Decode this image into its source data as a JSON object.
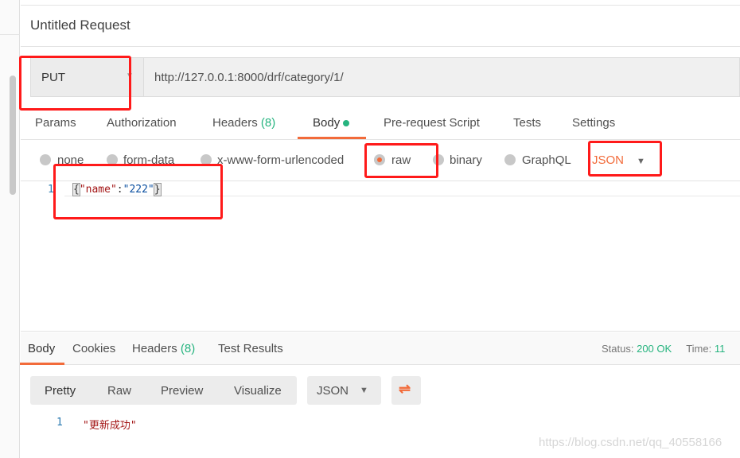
{
  "request": {
    "title": "Untitled Request",
    "method": "PUT",
    "url": "http://127.0.0.1:8000/drf/category/1/"
  },
  "tabs": [
    {
      "label": "Params"
    },
    {
      "label": "Authorization"
    },
    {
      "label": "Headers",
      "count": "(8)"
    },
    {
      "label": "Body"
    },
    {
      "label": "Pre-request Script"
    },
    {
      "label": "Tests"
    },
    {
      "label": "Settings"
    }
  ],
  "body_types": [
    "none",
    "form-data",
    "x-www-form-urlencoded",
    "raw",
    "binary",
    "GraphQL"
  ],
  "body_type_selected": "raw",
  "body_format": "JSON",
  "editor": {
    "line": "1",
    "brace_open": "{",
    "key": "\"name\"",
    "colon": ":",
    "value": "\"222\"",
    "brace_close": "}"
  },
  "response": {
    "tabs": [
      {
        "label": "Body"
      },
      {
        "label": "Cookies"
      },
      {
        "label": "Headers",
        "count": "(8)"
      },
      {
        "label": "Test Results"
      }
    ],
    "status_label": "Status:",
    "status_value": "200 OK",
    "time_label": "Time:",
    "time_value": "11",
    "view_modes": [
      "Pretty",
      "Raw",
      "Preview",
      "Visualize"
    ],
    "format": "JSON",
    "line": "1",
    "content": "\"更新成功\""
  },
  "watermark": "https://blog.csdn.net/qq_40558166",
  "colors": {
    "accent": "#f26b3a",
    "green": "#26b47f",
    "annotation": "#ff1a1a"
  }
}
